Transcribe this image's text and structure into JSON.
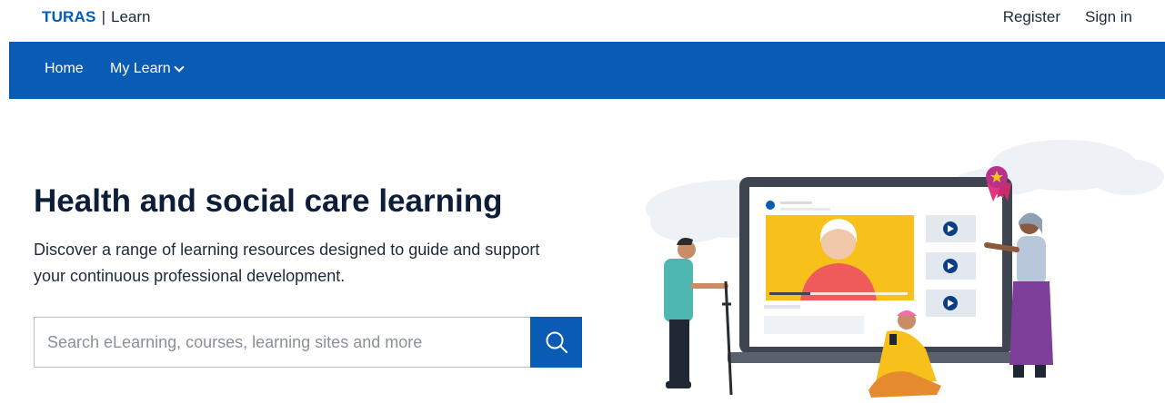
{
  "header": {
    "brand_primary": "TURAS",
    "brand_separator": "|",
    "brand_secondary": "Learn",
    "register_label": "Register",
    "signin_label": "Sign in"
  },
  "nav": {
    "home_label": "Home",
    "mylearn_label": "My Learn"
  },
  "hero": {
    "title": "Health and social care learning",
    "description": "Discover a range of learning resources designed to guide and support your continuous professional development."
  },
  "search": {
    "placeholder": "Search eLearning, courses, learning sites and more",
    "value": ""
  },
  "icons": {
    "search": "search-icon",
    "dropdown": "chevron-down-icon",
    "play": "play-icon",
    "award": "award-ribbon-icon"
  },
  "colors": {
    "brand_blue": "#0a5bb3",
    "title_navy": "#0f1e38",
    "video_yellow": "#f7c01b"
  }
}
